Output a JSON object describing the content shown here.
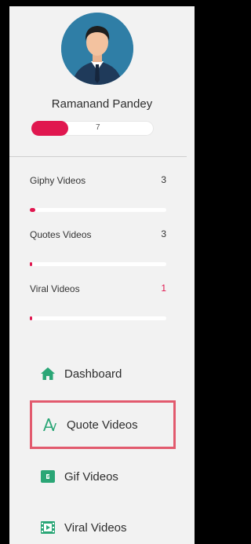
{
  "user": {
    "name": "Ramanand Pandey",
    "progress_value": "7",
    "progress_fraction": 0.3
  },
  "stats": [
    {
      "label": "Giphy Videos",
      "count": "3",
      "fraction": 0.04,
      "count_color": "#333333"
    },
    {
      "label": "Quotes Videos",
      "count": "3",
      "fraction": 0.01,
      "count_color": "#333333"
    },
    {
      "label": "Viral Videos",
      "count": "1",
      "fraction": 0.01,
      "count_color": "#e0174f"
    }
  ],
  "nav": [
    {
      "label": "Dashboard",
      "icon": "home-icon"
    },
    {
      "label": "Quote Videos",
      "icon": "quote-font-icon",
      "active": true
    },
    {
      "label": "Gif Videos",
      "icon": "gif-image-icon"
    },
    {
      "label": "Viral Videos",
      "icon": "film-icon"
    }
  ],
  "colors": {
    "accent": "#e0174f",
    "highlight_border": "#e25a6e",
    "icon_green": "#2aa676"
  }
}
